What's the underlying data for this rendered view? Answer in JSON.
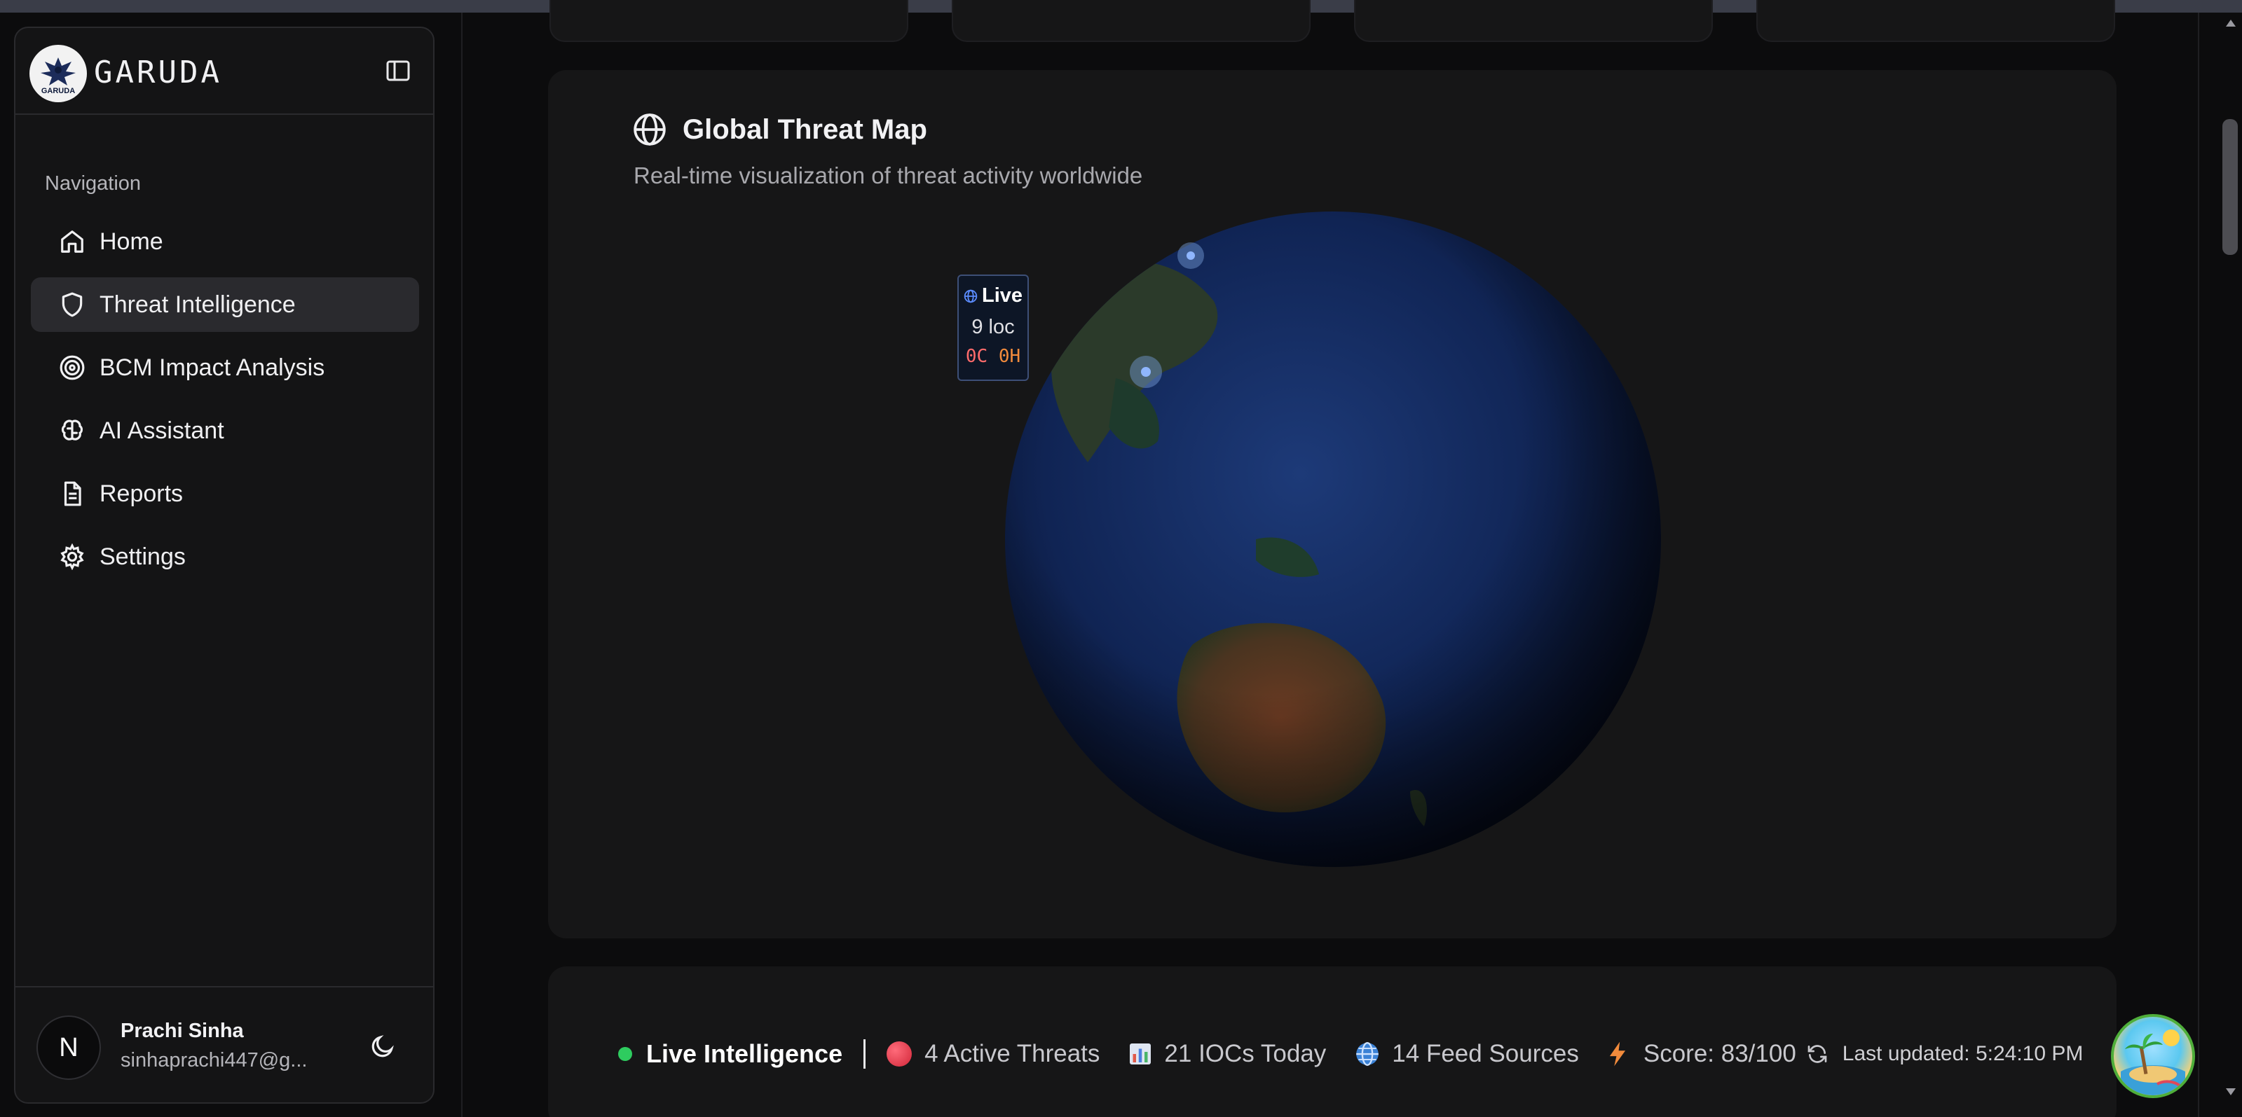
{
  "sidebar": {
    "brand": "GARUDA",
    "logo_small_text": "GARUDA",
    "nav_heading": "Navigation",
    "items": [
      {
        "label": "Home",
        "icon": "home-icon"
      },
      {
        "label": "Threat Intelligence",
        "icon": "shield-icon",
        "active": true
      },
      {
        "label": "BCM Impact Analysis",
        "icon": "target-icon"
      },
      {
        "label": "AI Assistant",
        "icon": "brain-icon"
      },
      {
        "label": "Reports",
        "icon": "document-icon"
      },
      {
        "label": "Settings",
        "icon": "gear-icon"
      }
    ],
    "user": {
      "initial": "N",
      "name": "Prachi Sinha",
      "email": "sinhaprachi447@g..."
    }
  },
  "map_card": {
    "title": "Global Threat Map",
    "subtitle": "Real-time visualization of threat activity worldwide",
    "popup": {
      "title": "Live",
      "locations": "9 loc",
      "critical": "0C",
      "high": "0H"
    }
  },
  "ticker": {
    "live_label": "Live Intelligence",
    "active_threats": "4 Active Threats",
    "iocs": "21 IOCs Today",
    "feeds": "14 Feed Sources",
    "score": "Score: 83/100",
    "last_updated": "Last updated: 5:24:10 PM"
  },
  "colors": {
    "background": "#0c0c0d",
    "card": "#161617",
    "active_nav": "#2a2a2e",
    "live_dot": "#2ecc5f",
    "threat_dot": "#d12638",
    "popup_accent": "#f28b3c"
  }
}
